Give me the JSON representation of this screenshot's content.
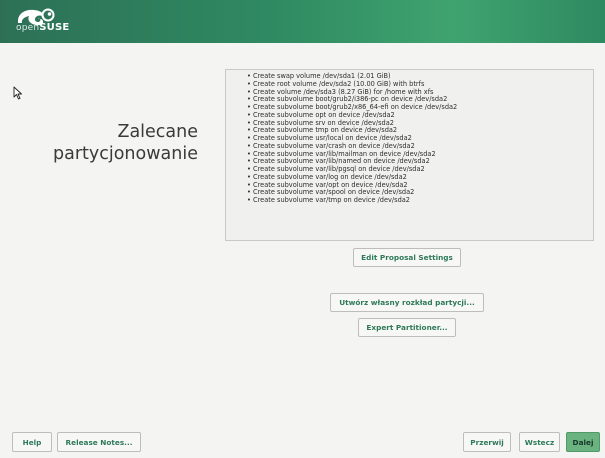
{
  "header": {
    "logo_light": "open",
    "logo_bold": "SUSE",
    "background_color": "#2f8a62"
  },
  "page_title_line1": "Zalecane",
  "page_title_line2": "partycjonowanie",
  "proposal": {
    "items": [
      "Create swap volume /dev/sda1 (2.01 GiB)",
      "Create root volume /dev/sda2 (10.00 GiB) with btrfs",
      "Create volume /dev/sda3 (8.27 GiB) for /home with xfs",
      "Create subvolume boot/grub2/i386-pc on device /dev/sda2",
      "Create subvolume boot/grub2/x86_64-efi on device /dev/sda2",
      "Create subvolume opt on device /dev/sda2",
      "Create subvolume srv on device /dev/sda2",
      "Create subvolume tmp on device /dev/sda2",
      "Create subvolume usr/local on device /dev/sda2",
      "Create subvolume var/crash on device /dev/sda2",
      "Create subvolume var/lib/mailman on device /dev/sda2",
      "Create subvolume var/lib/named on device /dev/sda2",
      "Create subvolume var/lib/pgsql on device /dev/sda2",
      "Create subvolume var/log on device /dev/sda2",
      "Create subvolume var/opt on device /dev/sda2",
      "Create subvolume var/spool on device /dev/sda2",
      "Create subvolume var/tmp on device /dev/sda2"
    ]
  },
  "buttons": {
    "edit_proposal": "Edit Proposal Settings",
    "own_layout": "Utwórz własny rozkład partycji...",
    "expert": "Expert Partitioner...",
    "help": "Help",
    "release_notes": "Release Notes...",
    "abort": "Przerwij",
    "back": "Wstecz",
    "next": "Dalej"
  },
  "colors": {
    "accent": "#2e7a58",
    "next_button": "#6ab27f",
    "background": "#f4f4f2"
  },
  "icons": {
    "logo": "opensuse-chameleon-icon",
    "cursor": "mouse-pointer-icon"
  }
}
